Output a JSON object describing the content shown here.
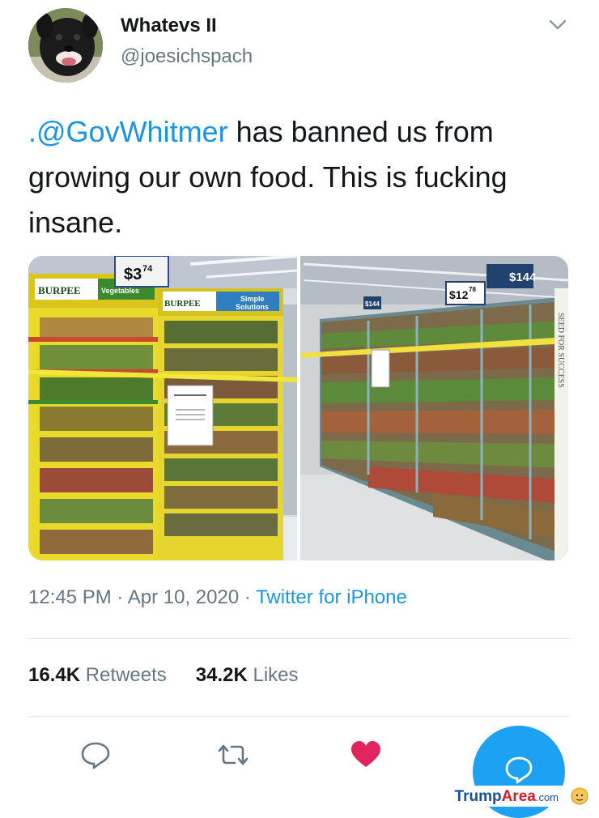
{
  "tweet": {
    "author_name": "Whatevs II",
    "author_handle": "@joesichspach",
    "mention": ".@GovWhitmer",
    "text_rest": " has banned us from growing our own food. This is fucking insane.",
    "time": "12:45 PM",
    "date": "Apr 10, 2020",
    "separator": "·",
    "source": "Twitter for iPhone",
    "retweets_count": "16.4K",
    "retweets_label": "Retweets",
    "likes_count": "34.2K",
    "likes_label": "Likes"
  },
  "photo_left": {
    "price_main": "$3",
    "price_cents": "74",
    "brand": "BURPEE",
    "brand2": "BURPEE",
    "label_vegetables": "Vegetables",
    "label_simple": "Simple",
    "label_solutions": "Solutions"
  },
  "photo_right": {
    "price1": "$144",
    "price2_main": "$12",
    "price2_cents": "78",
    "price3": "$144",
    "side_text": "SEED FOR SUCCESS"
  },
  "watermark": {
    "part1": "Trump",
    "part2": "Area",
    "part3": ".com"
  },
  "colors": {
    "link": "#1b95e0",
    "like_heart": "#e0245e",
    "fab": "#1da1f2"
  },
  "icons": [
    "chevron-down-icon",
    "reply-icon",
    "retweet-icon",
    "heart-icon",
    "compose-reply-icon"
  ]
}
